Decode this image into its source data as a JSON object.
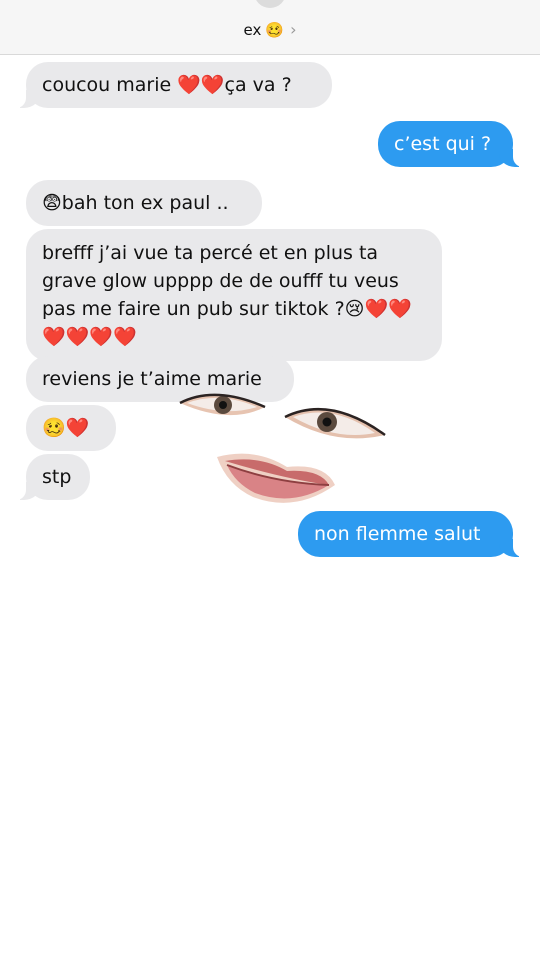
{
  "header": {
    "contact_name": "ex",
    "contact_emoji": "🥴",
    "chevron": "›"
  },
  "messages": [
    {
      "id": "m1",
      "direction": "incoming",
      "text": "coucou marie ❤️❤️ça va ?"
    },
    {
      "id": "m2",
      "direction": "outgoing",
      "text": "c’est qui ?"
    },
    {
      "id": "m3",
      "direction": "incoming",
      "text": "😨bah ton ex paul .."
    },
    {
      "id": "m4",
      "direction": "incoming",
      "text": "brefff j’ai vue ta percé et en plus ta grave glow upppp de de oufff tu veus pas me faire un pub sur tiktok ?😢❤️❤️❤️❤️❤️❤️"
    },
    {
      "id": "m5",
      "direction": "incoming",
      "text": "reviens je t’aime marie"
    },
    {
      "id": "m6",
      "direction": "incoming",
      "text": "🥴❤️"
    },
    {
      "id": "m7",
      "direction": "incoming",
      "text": "stp"
    },
    {
      "id": "m8",
      "direction": "outgoing",
      "text": "non flemme salut"
    }
  ],
  "colors": {
    "incoming_bubble": "#e9e9eb",
    "outgoing_bubble": "#2d9bf0",
    "heart": "#e0182d"
  },
  "overlay": {
    "description_icon": "face-sticker"
  }
}
